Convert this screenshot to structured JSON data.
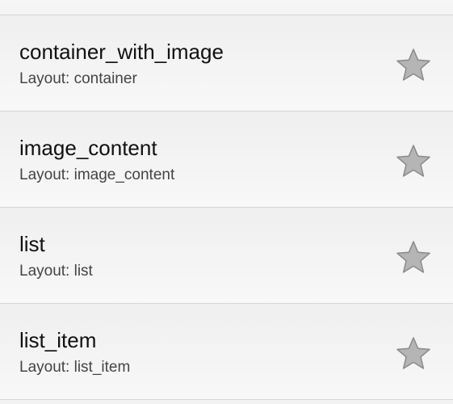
{
  "layouts": [
    {
      "title": "container_with_image",
      "subtitle": "Layout: container",
      "favorite_icon": "star-icon"
    },
    {
      "title": "image_content",
      "subtitle": "Layout: image_content",
      "favorite_icon": "star-icon"
    },
    {
      "title": "list",
      "subtitle": "Layout: list",
      "favorite_icon": "star-icon"
    },
    {
      "title": "list_item",
      "subtitle": "Layout: list_item",
      "favorite_icon": "star-icon"
    }
  ],
  "colors": {
    "star_fill": "#b5b5b5",
    "star_stroke": "#8a8a8a",
    "divider": "#d6d6d6"
  }
}
